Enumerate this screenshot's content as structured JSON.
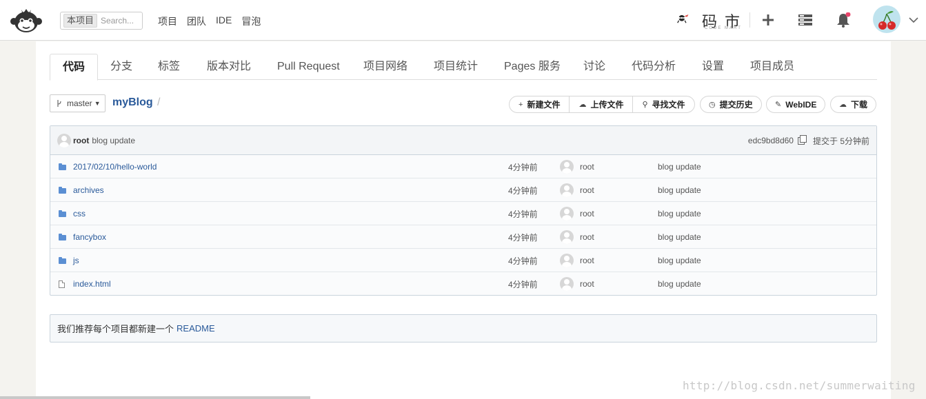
{
  "topbar": {
    "search_scope": "本项目",
    "search_placeholder": "Search...",
    "nav": [
      "项目",
      "团队",
      "IDE",
      "冒泡"
    ],
    "brand_text": "码 市",
    "brand_sub": "CODE MART"
  },
  "tabs": [
    "代码",
    "分支",
    "标签",
    "版本对比",
    "Pull Request",
    "项目网络",
    "项目统计",
    "Pages 服务",
    "讨论",
    "代码分析",
    "设置",
    "项目成员"
  ],
  "active_tab": "代码",
  "repo": {
    "branch": "master",
    "name": "myBlog",
    "slash": "/"
  },
  "actions": {
    "new_file": "新建文件",
    "upload_file": "上传文件",
    "find_file": "寻找文件",
    "history": "提交历史",
    "webide": "WebIDE",
    "download": "下载"
  },
  "last_commit": {
    "author": "root",
    "message": "blog update",
    "hash": "edc9bd8d60",
    "time": "提交于 5分钟前"
  },
  "files": [
    {
      "name": "2017/02/10/hello-world",
      "type": "folder",
      "time": "4分钟前",
      "author": "root",
      "message": "blog update"
    },
    {
      "name": "archives",
      "type": "folder",
      "time": "4分钟前",
      "author": "root",
      "message": "blog update"
    },
    {
      "name": "css",
      "type": "folder",
      "time": "4分钟前",
      "author": "root",
      "message": "blog update"
    },
    {
      "name": "fancybox",
      "type": "folder",
      "time": "4分钟前",
      "author": "root",
      "message": "blog update"
    },
    {
      "name": "js",
      "type": "folder",
      "time": "4分钟前",
      "author": "root",
      "message": "blog update"
    },
    {
      "name": "index.html",
      "type": "file",
      "time": "4分钟前",
      "author": "root",
      "message": "blog update"
    }
  ],
  "readme": {
    "text": "我们推荐每个项目都新建一个",
    "link": "README"
  },
  "watermark": "http://blog.csdn.net/summerwaiting",
  "colors": {
    "link": "#2a5a9a",
    "folder": "#5b8fd3",
    "notification_dot": "#e8456b"
  }
}
